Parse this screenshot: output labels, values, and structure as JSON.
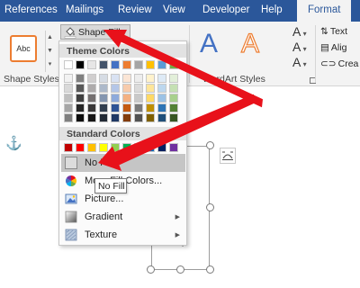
{
  "ribbon_tabs": [
    {
      "label": "References"
    },
    {
      "label": "Mailings"
    },
    {
      "label": "Review"
    },
    {
      "label": "View"
    },
    {
      "label": "Developer"
    },
    {
      "label": "Help"
    },
    {
      "label": "Format",
      "active": true
    }
  ],
  "ribbon": {
    "shape_style_sample": "Abc",
    "shape_fill_label": "Shape Fill",
    "group_shape_styles": "Shape Styles",
    "group_wordart_styles": "WordArt Styles",
    "wordart_letter": "A",
    "text_tool_letter": "A",
    "right_items": [
      "Text",
      "Alig",
      "Crea"
    ]
  },
  "dropdown": {
    "theme_colors_header": "Theme Colors",
    "standard_colors_header": "Standard Colors",
    "theme_top_row": [
      "#ffffff",
      "#000000",
      "#e7e6e6",
      "#44546a",
      "#4472c4",
      "#ed7d31",
      "#a5a5a5",
      "#ffc000",
      "#5b9bd5",
      "#70ad47"
    ],
    "theme_shades": [
      [
        "#f2f2f2",
        "#808080",
        "#d0cece",
        "#d6dce4",
        "#d9e2f3",
        "#fbe5d5",
        "#ededed",
        "#fff2cc",
        "#deeaf6",
        "#e2efd9"
      ],
      [
        "#d9d9d9",
        "#595959",
        "#aeabab",
        "#adb9ca",
        "#b4c6e7",
        "#f7cbac",
        "#dbdbdb",
        "#fee599",
        "#bdd7ee",
        "#c5e0b3"
      ],
      [
        "#bfbfbf",
        "#404040",
        "#757070",
        "#8496b0",
        "#8eaadb",
        "#f4b183",
        "#c9c9c9",
        "#ffd965",
        "#9cc2e5",
        "#a8d08d"
      ],
      [
        "#a6a6a6",
        "#262626",
        "#3a3838",
        "#323f4f",
        "#2f5496",
        "#c55a11",
        "#7b7b7b",
        "#bf8f00",
        "#2e74b5",
        "#538135"
      ],
      [
        "#7f7f7f",
        "#0d0d0d",
        "#171616",
        "#222a35",
        "#1f3864",
        "#833c0b",
        "#525252",
        "#7f6000",
        "#1f4e79",
        "#375623"
      ]
    ],
    "standard_colors": [
      "#c00000",
      "#ff0000",
      "#ffc000",
      "#ffff00",
      "#92d050",
      "#00b050",
      "#00b0f0",
      "#0070c0",
      "#002060",
      "#7030a0"
    ],
    "items": [
      {
        "label": "No Fill",
        "icon": "no-fill-icon",
        "hover": true
      },
      {
        "label": "More Fill Colors...",
        "icon": "color-wheel-icon"
      },
      {
        "label": "Picture...",
        "icon": "picture-icon"
      },
      {
        "label": "Gradient",
        "icon": "gradient-icon",
        "submenu": true
      },
      {
        "label": "Texture",
        "icon": "texture-icon",
        "submenu": true
      }
    ],
    "tooltip": "No Fill"
  },
  "icons": {
    "anchor": "anchor-icon",
    "bucket": "paint-bucket-icon",
    "layout_options": "layout-options-icon"
  },
  "colors": {
    "tab_bar": "#2b579a",
    "ribbon_bg": "#f3f3f3",
    "arrow": "#e8111a",
    "accent_orange": "#ed7d31",
    "accent_blue": "#4472c4"
  }
}
